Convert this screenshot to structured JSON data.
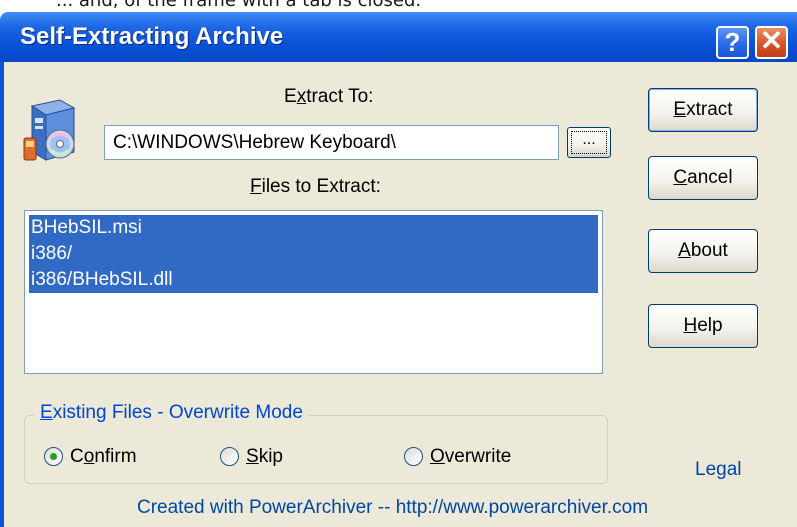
{
  "top_strip_text": "... and, of the frame with a tab is closed.",
  "window": {
    "title": "Self-Extracting Archive",
    "help_glyph": "?",
    "close_glyph": "✕"
  },
  "extract_to": {
    "label_before": "E",
    "label_mnemonic": "x",
    "label_after": "tract To:",
    "path_value": "C:\\WINDOWS\\Hebrew Keyboard\\",
    "browse_label": "..."
  },
  "files": {
    "label_mnemonic": "F",
    "label_after": "iles to Extract:",
    "items": [
      "BHebSIL.msi",
      "i386/",
      "i386/BHebSIL.dll"
    ]
  },
  "buttons": {
    "extract": {
      "mnemonic": "E",
      "rest": "xtract"
    },
    "cancel": {
      "mnemonic": "C",
      "rest": "ancel"
    },
    "about": {
      "mnemonic": "A",
      "rest": "bout"
    },
    "help": {
      "mnemonic": "H",
      "rest": "elp"
    }
  },
  "overwrite_mode": {
    "legend_mnemonic": "E",
    "legend_rest": "xisting Files - Overwrite Mode",
    "options": [
      {
        "before": "C",
        "mnemonic": "o",
        "after": "nfirm",
        "selected": true
      },
      {
        "before": "",
        "mnemonic": "S",
        "after": "kip",
        "selected": false
      },
      {
        "before": "",
        "mnemonic": "O",
        "after": "verwrite",
        "selected": false
      }
    ]
  },
  "legal_link": "Legal",
  "footer": "Created with PowerArchiver  --  http://www.powerarchiver.com",
  "colors": {
    "titlebar": "#0b53da",
    "dialog_bg": "#ece9d8",
    "selection": "#316ac5",
    "link": "#0046a5",
    "radio_dot": "#21a121"
  },
  "icons": {
    "app": "installer-cd-icon",
    "help": "help-icon",
    "close": "close-icon"
  }
}
